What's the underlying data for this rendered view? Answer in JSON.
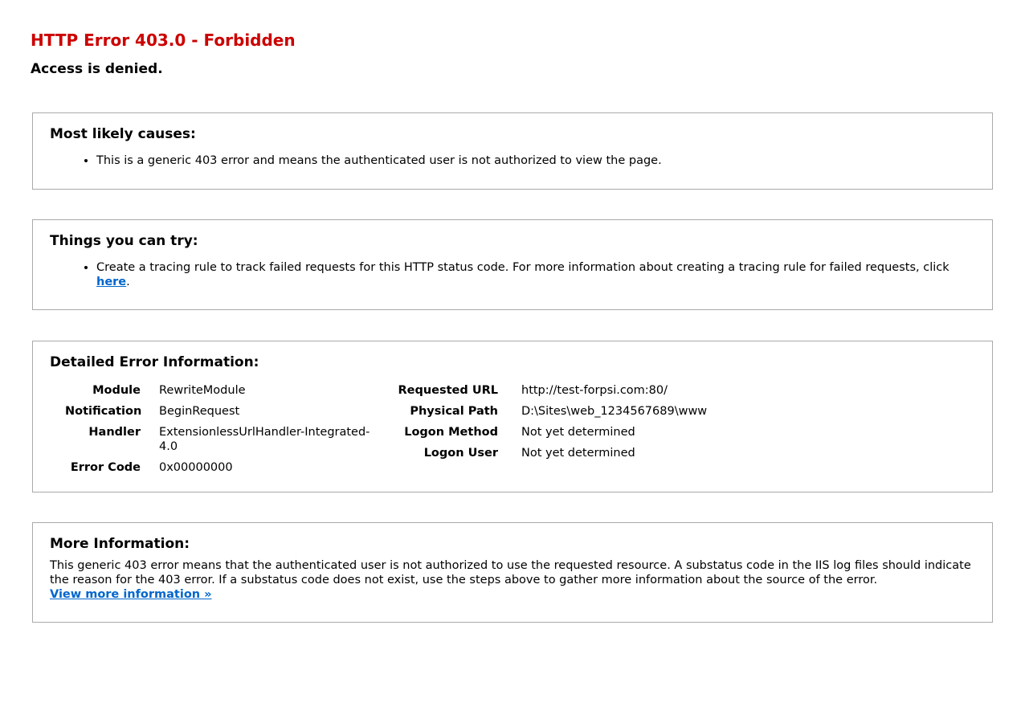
{
  "header": {
    "title": "HTTP Error 403.0 - Forbidden",
    "subtitle": "Access is denied."
  },
  "causes": {
    "heading": "Most likely causes:",
    "items": [
      "This is a generic 403 error and means the authenticated user is not authorized to view the page."
    ]
  },
  "try": {
    "heading": "Things you can try:",
    "item_text": "Create a tracing rule to track failed requests for this HTTP status code. For more information about creating a tracing rule for failed requests, click ",
    "link_label": "here",
    "item_suffix": "."
  },
  "detail": {
    "heading": "Detailed Error Information:",
    "left": [
      {
        "key": "Module",
        "value": "RewriteModule"
      },
      {
        "key": "Notification",
        "value": "BeginRequest"
      },
      {
        "key": "Handler",
        "value": "ExtensionlessUrlHandler-Integrated-4.0"
      },
      {
        "key": "Error Code",
        "value": "0x00000000"
      }
    ],
    "right": [
      {
        "key": "Requested URL",
        "value": "http://test-forpsi.com:80/"
      },
      {
        "key": "Physical Path",
        "value": "D:\\Sites\\web_1234567689\\www"
      },
      {
        "key": "Logon Method",
        "value": "Not yet determined"
      },
      {
        "key": "Logon User",
        "value": "Not yet determined"
      }
    ]
  },
  "more": {
    "heading": "More Information:",
    "text": "This generic 403 error means that the authenticated user is not authorized to use the requested resource. A substatus code in the IIS log files should indicate the reason for the 403 error. If a substatus code does not exist, use the steps above to gather more information about the source of the error.",
    "link_label": "View more information »"
  },
  "colors": {
    "title": "#cc0000",
    "link": "#0066cc",
    "border": "#a9a9a9"
  }
}
